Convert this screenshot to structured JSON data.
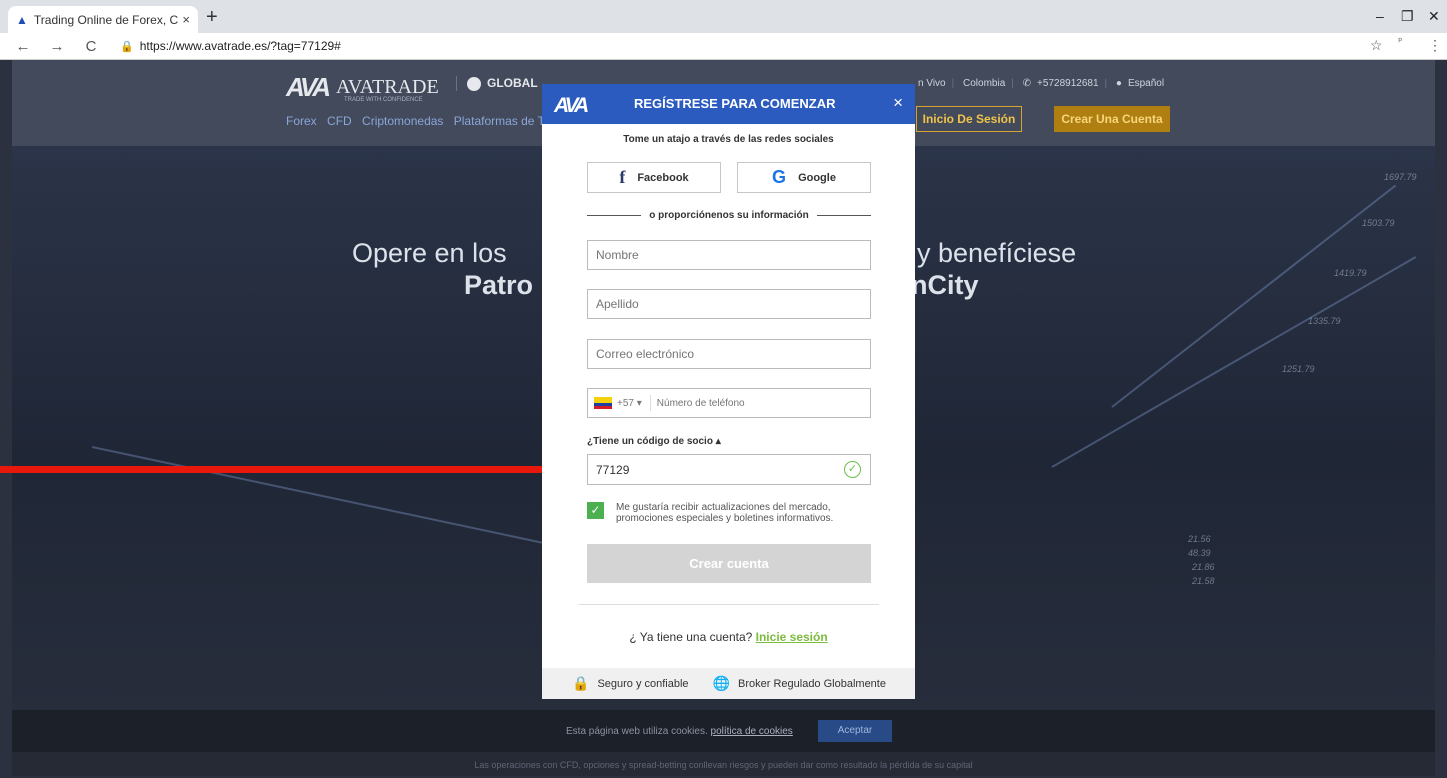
{
  "browser": {
    "tab_title": "Trading Online de Forex, CFDs y C",
    "tab_close": "×",
    "new_tab": "+",
    "url": "https://www.avatrade.es/?tag=77129#",
    "back": "←",
    "forward": "→",
    "reload": "C",
    "lock": "🔒",
    "star": "☆",
    "menu": "⋮",
    "minimize": "–",
    "maximize": "❐",
    "close": "✕"
  },
  "site": {
    "logo_mark": "AVA",
    "logo_name": "AVATRADE",
    "logo_tagline": "TRADE WITH CONFIDENCE",
    "global_label": "GLOBAL",
    "nav": [
      "Forex",
      "CFD",
      "Criptomonedas",
      "Plataformas de Tr"
    ],
    "top_links": {
      "live": "n Vivo",
      "country": "Colombia",
      "phone": "+5728912681",
      "language": "Español"
    },
    "login_button": "Inicio De Sesión",
    "signup_button": "Crear Una Cuenta",
    "hero_line1_left": "Opere en los",
    "hero_line1_right": "y benefíciese",
    "hero_line2_left": "Patro",
    "hero_line2_right": "nCity",
    "tickers": [
      "1697.79",
      "1503.79",
      "1419.79",
      "1335.79",
      "1251.79",
      "21.56",
      "48.39",
      "21.86",
      "21.58"
    ],
    "cookie_text": "Esta página web utiliza cookies.",
    "cookie_link": "política de cookies",
    "cookie_accept": "Aceptar",
    "risk_warning": "Las operaciones con CFD, opciones y spread-betting conllevan riesgos y pueden dar como resultado la pérdida de su capital"
  },
  "modal": {
    "logo": "AVA",
    "title": "REGÍSTRESE PARA COMENZAR",
    "close": "×",
    "subtitle": "Tome un atajo a través de las redes sociales",
    "facebook_icon": "f",
    "facebook_label": "Facebook",
    "google_icon": "G",
    "google_label": "Google",
    "divider_text": "o proporciónenos su información",
    "first_name_placeholder": "Nombre",
    "last_name_placeholder": "Apellido",
    "email_placeholder": "Correo electrónico",
    "country_code": "+57",
    "country_code_caret": "▾",
    "phone_placeholder": "Número de teléfono",
    "partner_label": "¿Tiene un código de socio",
    "partner_caret": "▴",
    "partner_code": "77129",
    "valid_icon": "✓",
    "checkbox_mark": "✓",
    "newsletter_text": "Me gustaría recibir actualizaciones del mercado, promociones especiales y boletines informativos.",
    "create_button": "Crear cuenta",
    "have_account": "¿ Ya tiene una cuenta?",
    "login_link": "Inicie sesión",
    "lock_icon": "🔒",
    "secure_text": "Seguro y confiable",
    "globe_icon": "🌐",
    "regulated_text": "Broker Regulado Globalmente"
  },
  "colors": {
    "modal_header": "#2b5bbf",
    "checkbox": "#4caf50",
    "login_link": "#7cbb3e",
    "arrow": "#e8180c"
  }
}
